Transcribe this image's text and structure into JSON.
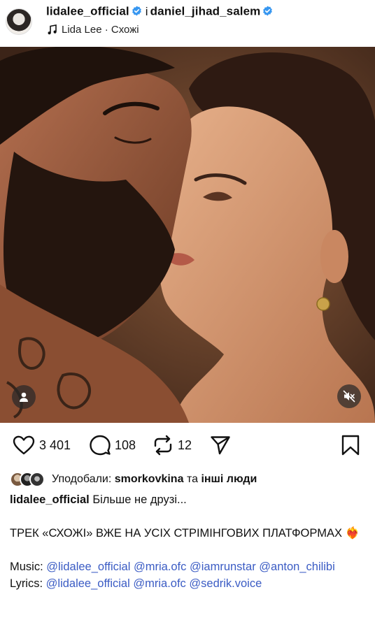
{
  "header": {
    "author": "lidalee_official",
    "connector": "i",
    "coauthor": "daniel_jihad_salem",
    "audio": "Lida Lee · Схожі"
  },
  "media": {
    "description_icons": [
      "user-tag-icon",
      "mute-icon"
    ]
  },
  "actions": {
    "likes_count": "3 401",
    "comments_count": "108",
    "reposts_count": "12"
  },
  "liked_by": {
    "prefix": "Уподобали:",
    "user": "smorkovkina",
    "connector": "та",
    "others": "інші люди"
  },
  "caption": {
    "username": "lidalee_official",
    "first_line": "Більше не друзі...",
    "line2": "ТРЕК «СХОЖІ» ВЖЕ НА УСІХ СТРІМІНГОВИХ ПЛАТФОРМАХ ❤️‍🔥",
    "music_label": "Music:",
    "music_mentions": [
      "@lidalee_official",
      "@mria.ofc",
      "@iamrunstar",
      "@anton_chilibi"
    ],
    "lyrics_label": "Lyrics:",
    "lyrics_mentions": [
      "@lidalee_official",
      "@mria.ofc",
      "@sedrik.voice"
    ]
  },
  "colors": {
    "verified": "#3897f0",
    "link": "#3b5cc4"
  }
}
